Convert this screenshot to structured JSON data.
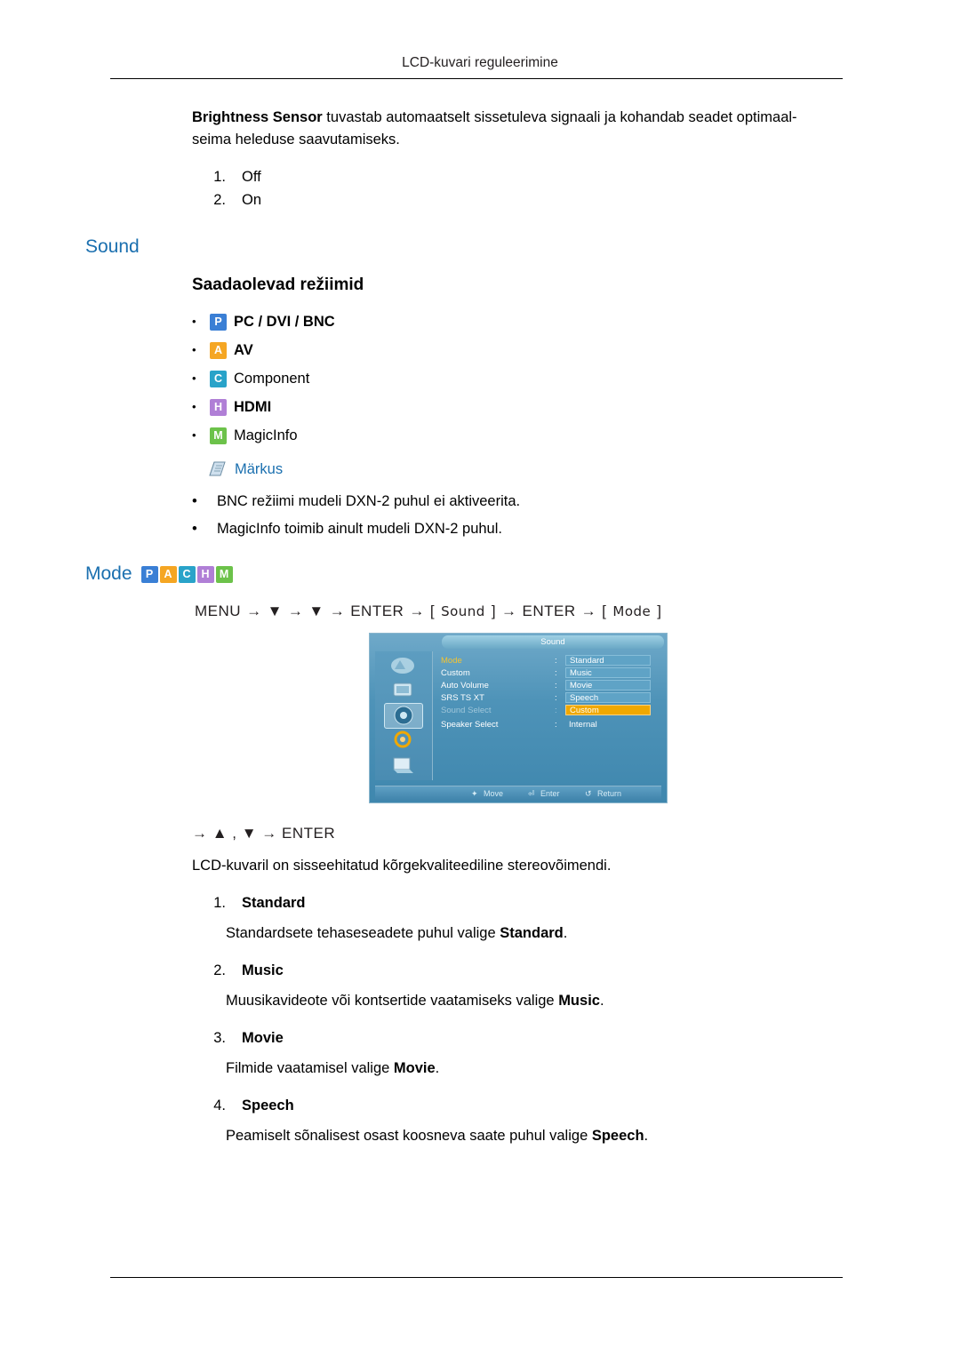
{
  "header": {
    "title": "LCD-kuvari reguleerimine"
  },
  "intro": {
    "bold_lead": "Brightness Sensor",
    "rest": " tuvastab automaatselt sissetuleva signaali ja kohandab seadet optimaal-",
    "line2": "seima heleduse saavutamiseks."
  },
  "brightness_options": [
    {
      "num": "1.",
      "label": "Off"
    },
    {
      "num": "2.",
      "label": "On"
    }
  ],
  "sound_section": {
    "title": "Sound",
    "subtitle": "Saadaolevad režiimid",
    "modes": [
      {
        "badge": "P",
        "badge_class": "badge-P",
        "label": "PC / DVI / BNC"
      },
      {
        "badge": "A",
        "badge_class": "badge-A",
        "label": "AV"
      },
      {
        "badge": "C",
        "badge_class": "badge-C",
        "label": "Component"
      },
      {
        "badge": "H",
        "badge_class": "badge-H",
        "label": "HDMI"
      },
      {
        "badge": "M",
        "badge_class": "badge-M",
        "label": "MagicInfo"
      }
    ],
    "note_label": "Märkus",
    "notes": [
      "BNC režiimi mudeli DXN-2 puhul ei aktiveerita.",
      "MagicInfo toimib ainult mudeli DXN-2 puhul."
    ]
  },
  "mode_section": {
    "title": "Mode",
    "badges": [
      {
        "badge": "P",
        "badge_class": "badge-P"
      },
      {
        "badge": "A",
        "badge_class": "badge-A"
      },
      {
        "badge": "C",
        "badge_class": "badge-C"
      },
      {
        "badge": "H",
        "badge_class": "badge-H"
      },
      {
        "badge": "M",
        "badge_class": "badge-M"
      }
    ],
    "menu_path": {
      "t1": "MENU",
      "a1": "→",
      "d1": "▼",
      "a2": "→",
      "d2": "▼",
      "a3": "→",
      "t2": "ENTER",
      "a4": "→",
      "tag1": "Sound",
      "a5": "→",
      "t3": "ENTER",
      "a6": "→",
      "tag2": "Mode"
    },
    "after_path": "→ ▲ , ▼ → ENTER",
    "description": "LCD-kuvaril on sisseehitatud kõrgekvaliteediline stereovõimendi.",
    "items": [
      {
        "num": "1.",
        "label": "Standard",
        "desc_pre": "Standardsete tehaseseadete puhul valige ",
        "desc_bold": "Standard",
        "desc_post": "."
      },
      {
        "num": "2.",
        "label": "Music",
        "desc_pre": "Muusikavideote või kontsertide vaatamiseks valige ",
        "desc_bold": "Music",
        "desc_post": "."
      },
      {
        "num": "3.",
        "label": "Movie",
        "desc_pre": "Filmide vaatamisel valige ",
        "desc_bold": "Movie",
        "desc_post": "."
      },
      {
        "num": "4.",
        "label": "Speech",
        "desc_pre": "Peamiselt sõnalisest osast koosneva saate puhul valige ",
        "desc_bold": "Speech",
        "desc_post": "."
      }
    ]
  },
  "osd": {
    "title": "Sound",
    "rows": [
      {
        "label": "Mode",
        "colon": ":",
        "value": "Standard",
        "label_state": "highlight",
        "value_state": "box"
      },
      {
        "label": "Custom",
        "colon": ":",
        "value": "Music",
        "label_state": "normal",
        "value_state": "box"
      },
      {
        "label": "Auto Volume",
        "colon": ":",
        "value": "Movie",
        "label_state": "normal",
        "value_state": "box"
      },
      {
        "label": "SRS TS XT",
        "colon": ":",
        "value": "Speech",
        "label_state": "normal",
        "value_state": "box"
      },
      {
        "label": "Sound Select",
        "colon": ":",
        "value": "Custom",
        "label_state": "dim",
        "value_state": "selected"
      },
      {
        "label": "Speaker Select",
        "colon": ":",
        "value": "Internal",
        "label_state": "normal",
        "value_state": "plain"
      }
    ],
    "footer": {
      "move": "Move",
      "enter": "Enter",
      "return": "Return"
    }
  }
}
